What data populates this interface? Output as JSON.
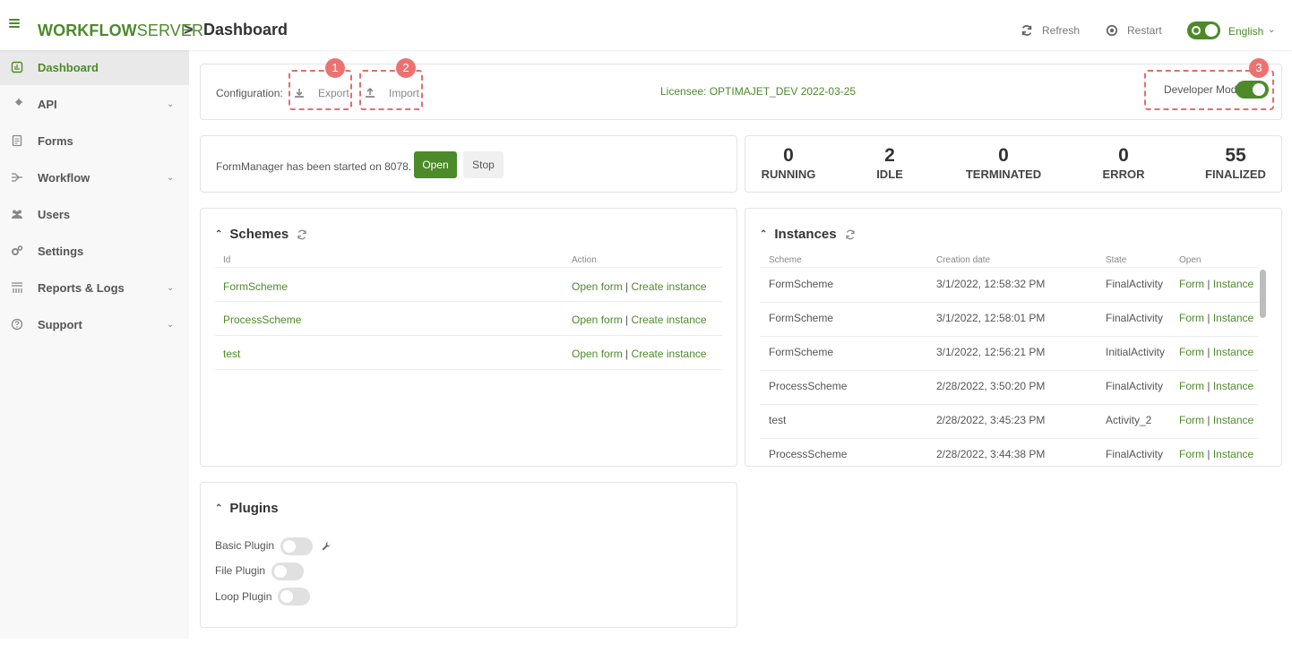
{
  "topbar": {
    "logo_bold": "WORKFLOW",
    "logo_light": "SERVER",
    "crumb_separator": ">",
    "title": "Dashboard",
    "refresh_label": "Refresh",
    "restart_label": "Restart",
    "language": "English",
    "language_toggle_on": true
  },
  "sidebar": {
    "items": [
      {
        "label": "Dashboard",
        "icon": "dashboard-icon",
        "active": true,
        "expandable": false
      },
      {
        "label": "API",
        "icon": "plug-icon",
        "active": false,
        "expandable": true
      },
      {
        "label": "Forms",
        "icon": "form-icon",
        "active": false,
        "expandable": false
      },
      {
        "label": "Workflow",
        "icon": "workflow-icon",
        "active": false,
        "expandable": true
      },
      {
        "label": "Users",
        "icon": "users-icon",
        "active": false,
        "expandable": false
      },
      {
        "label": "Settings",
        "icon": "gears-icon",
        "active": false,
        "expandable": false
      },
      {
        "label": "Reports & Logs",
        "icon": "reports-icon",
        "active": false,
        "expandable": true
      },
      {
        "label": "Support",
        "icon": "help-icon",
        "active": false,
        "expandable": true
      }
    ]
  },
  "config": {
    "label": "Configuration:",
    "export_label": "Export",
    "import_label": "Import",
    "licensee": "Licensee: OPTIMAJET_DEV 2022-03-25",
    "developer_mode_label": "Developer Mode",
    "developer_mode_on": true,
    "badges": [
      "1",
      "2",
      "3"
    ]
  },
  "form_manager": {
    "status_text": "FormManager has been started on 8078.",
    "open_label": "Open",
    "stop_label": "Stop"
  },
  "stats": [
    {
      "value": "0",
      "label": "RUNNING"
    },
    {
      "value": "2",
      "label": "IDLE"
    },
    {
      "value": "0",
      "label": "TERMINATED"
    },
    {
      "value": "0",
      "label": "ERROR"
    },
    {
      "value": "55",
      "label": "FINALIZED"
    }
  ],
  "schemes": {
    "title": "Schemes",
    "columns": [
      "Id",
      "Action"
    ],
    "rows": [
      {
        "id": "FormScheme",
        "action1": "Open form",
        "action2": "Create instance"
      },
      {
        "id": "ProcessScheme",
        "action1": "Open form",
        "action2": "Create instance"
      },
      {
        "id": "test",
        "action1": "Open form",
        "action2": "Create instance"
      }
    ],
    "action_separator": "|"
  },
  "instances": {
    "title": "Instances",
    "columns": [
      "Scheme",
      "Creation date",
      "State",
      "Open"
    ],
    "rows": [
      {
        "scheme": "FormScheme",
        "date": "3/1/2022, 12:58:32 PM",
        "state": "FinalActivity",
        "open1": "Form",
        "open2": "Instance"
      },
      {
        "scheme": "FormScheme",
        "date": "3/1/2022, 12:58:01 PM",
        "state": "FinalActivity",
        "open1": "Form",
        "open2": "Instance"
      },
      {
        "scheme": "FormScheme",
        "date": "3/1/2022, 12:56:21 PM",
        "state": "InitialActivity",
        "open1": "Form",
        "open2": "Instance"
      },
      {
        "scheme": "ProcessScheme",
        "date": "2/28/2022, 3:50:20 PM",
        "state": "FinalActivity",
        "open1": "Form",
        "open2": "Instance"
      },
      {
        "scheme": "test",
        "date": "2/28/2022, 3:45:23 PM",
        "state": "Activity_2",
        "open1": "Form",
        "open2": "Instance"
      },
      {
        "scheme": "ProcessScheme",
        "date": "2/28/2022, 3:44:38 PM",
        "state": "FinalActivity",
        "open1": "Form",
        "open2": "Instance"
      }
    ],
    "open_separator": "|"
  },
  "plugins": {
    "title": "Plugins",
    "items": [
      {
        "label": "Basic Plugin",
        "enabled": false,
        "has_settings": true
      },
      {
        "label": "File Plugin",
        "enabled": false,
        "has_settings": false
      },
      {
        "label": "Loop Plugin",
        "enabled": false,
        "has_settings": false
      }
    ]
  },
  "colors": {
    "accent": "#4d8a2a",
    "highlight": "#e96b6b",
    "sidebar_bg": "#f8f8f8"
  }
}
